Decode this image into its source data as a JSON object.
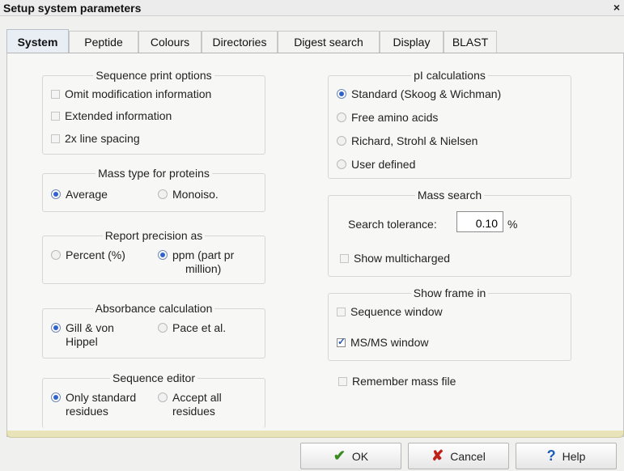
{
  "window": {
    "title": "Setup system parameters",
    "close": "×"
  },
  "tabs": [
    {
      "label": "System",
      "active": true
    },
    {
      "label": "Peptide"
    },
    {
      "label": "Colours"
    },
    {
      "label": "Directories"
    },
    {
      "label": "Digest search"
    },
    {
      "label": "Display"
    },
    {
      "label": "BLAST"
    }
  ],
  "sequence_print": {
    "title": "Sequence print options",
    "options": [
      {
        "label": "Omit modification information",
        "checked": false
      },
      {
        "label": "Extended information",
        "checked": false
      },
      {
        "label": "2x line spacing",
        "checked": false
      }
    ]
  },
  "mass_type": {
    "title": "Mass type for proteins",
    "options": [
      {
        "label": "Average",
        "selected": true
      },
      {
        "label": "Monoiso.",
        "selected": false
      }
    ]
  },
  "report_precision": {
    "title": "Report precision as",
    "options": [
      {
        "label": "Percent (%)",
        "selected": false
      },
      {
        "label_line1": "ppm (part pr",
        "label_line2": "million)",
        "selected": true
      }
    ]
  },
  "absorbance": {
    "title": "Absorbance calculation",
    "options": [
      {
        "label_line1": "Gill & von",
        "label_line2": "Hippel",
        "selected": true
      },
      {
        "label": "Pace et al.",
        "selected": false
      }
    ]
  },
  "sequence_editor": {
    "title": "Sequence editor",
    "options": [
      {
        "label_line1": "Only standard",
        "label_line2": "residues",
        "selected": true
      },
      {
        "label_line1": "Accept all",
        "label_line2": "residues",
        "selected": false
      }
    ]
  },
  "pi_calc": {
    "title": "pI calculations",
    "options": [
      {
        "label": "Standard (Skoog & Wichman)",
        "selected": true
      },
      {
        "label": "Free amino acids",
        "selected": false
      },
      {
        "label": "Richard, Strohl & Nielsen",
        "selected": false
      },
      {
        "label": "User defined",
        "selected": false
      }
    ]
  },
  "mass_search": {
    "title": "Mass search",
    "tolerance_label": "Search tolerance:",
    "tolerance_value": "0.10",
    "unit": "%",
    "multicharged_label": "Show multicharged",
    "multicharged_checked": false
  },
  "show_frame": {
    "title": "Show frame in",
    "options": [
      {
        "label": "Sequence window",
        "checked": false
      },
      {
        "label": "MS/MS window",
        "checked": true
      }
    ]
  },
  "remember_mass_file": {
    "label": "Remember mass file",
    "checked": false
  },
  "buttons": {
    "ok": "OK",
    "cancel": "Cancel",
    "help": "Help"
  }
}
